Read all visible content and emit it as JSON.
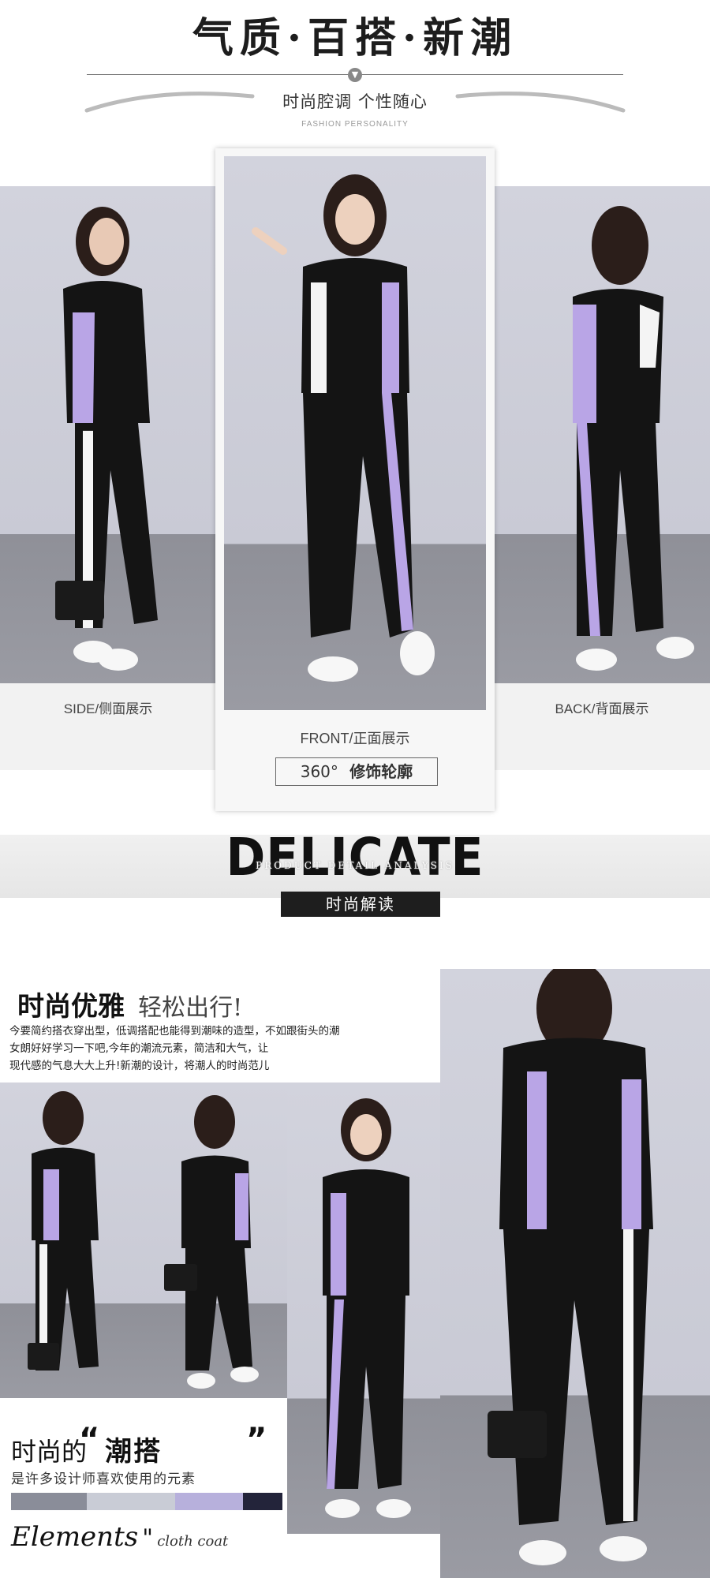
{
  "header": {
    "title": "气质·百搭·新潮",
    "subtitle": "时尚腔调  个性随心",
    "subtitle_en": "FASHION PERSONALITY"
  },
  "views": {
    "side_label": "SIDE/侧面展示",
    "front_label": "FRONT/正面展示",
    "back_label": "BACK/背面展示",
    "badge_360": "360°",
    "badge_text": "修饰轮廓"
  },
  "delicate": {
    "title": "DELICATE",
    "overlay": "PRODUCT DETAIL ANALYSIS",
    "bar": "时尚解读"
  },
  "promo": {
    "heading_bold": "时尚优雅",
    "heading_light": "轻松出行!",
    "body_line1": "今要简约搭衣穿出型，低调搭配也能得到潮味的造型，不如跟街头的潮",
    "body_line2": "女朗好好学习一下吧,今年的潮流元素，简洁和大气，让",
    "body_line3": "现代感的气息大大上升!新潮的设计，将潮人的时尚范儿",
    "bottom_prefix": "时尚的",
    "bottom_highlight": "潮搭",
    "bottom_sub": "是许多设计师喜欢使用的元素",
    "elements_script": "Elements",
    "elements_small": "cloth coat"
  },
  "colors": {
    "accent_lavender": "#b9a5e6",
    "garment_black": "#141414",
    "photo_bg": "#cfd0da"
  }
}
